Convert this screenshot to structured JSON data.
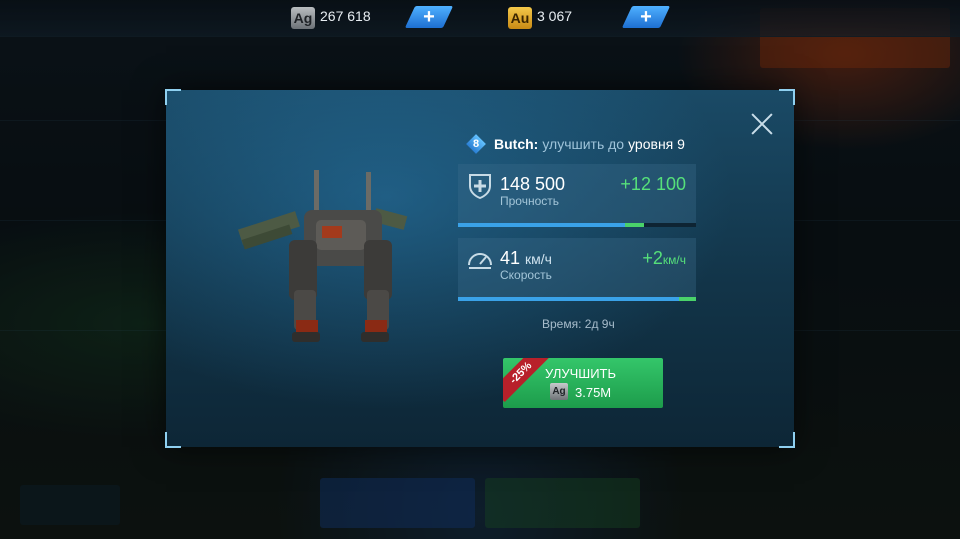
{
  "currencies": {
    "silver": {
      "badge": "Ag",
      "amount": "267 618"
    },
    "gold": {
      "badge": "Au",
      "amount": "3 067"
    },
    "plus_symbol": "+"
  },
  "dialog": {
    "robot_level": "8",
    "robot_name": "Butch:",
    "title_mid": "улучшить до",
    "title_end": "уровня 9",
    "stats": [
      {
        "icon": "shield-plus-icon",
        "value": "148 500",
        "unit": "",
        "label": "Прочность",
        "bonus": "+12 100",
        "bonus_unit": "",
        "current_fraction": 0.7,
        "added_fraction": 0.08
      },
      {
        "icon": "speedometer-icon",
        "value": "41",
        "unit": "км/ч",
        "label": "Скорость",
        "bonus": "+2",
        "bonus_unit": "км/ч",
        "current_fraction": 0.93,
        "added_fraction": 0.07
      }
    ],
    "time_label": "Время: 2д 9ч",
    "upgrade": {
      "label": "УЛУЧШИТЬ",
      "price_badge": "Ag",
      "price": "3.75M",
      "discount": "-25%"
    }
  },
  "colors": {
    "accent_blue": "#3aa2e8",
    "bonus_green": "#56e07a",
    "button_green": "#2bb35d",
    "discount_red": "#b8202a"
  }
}
